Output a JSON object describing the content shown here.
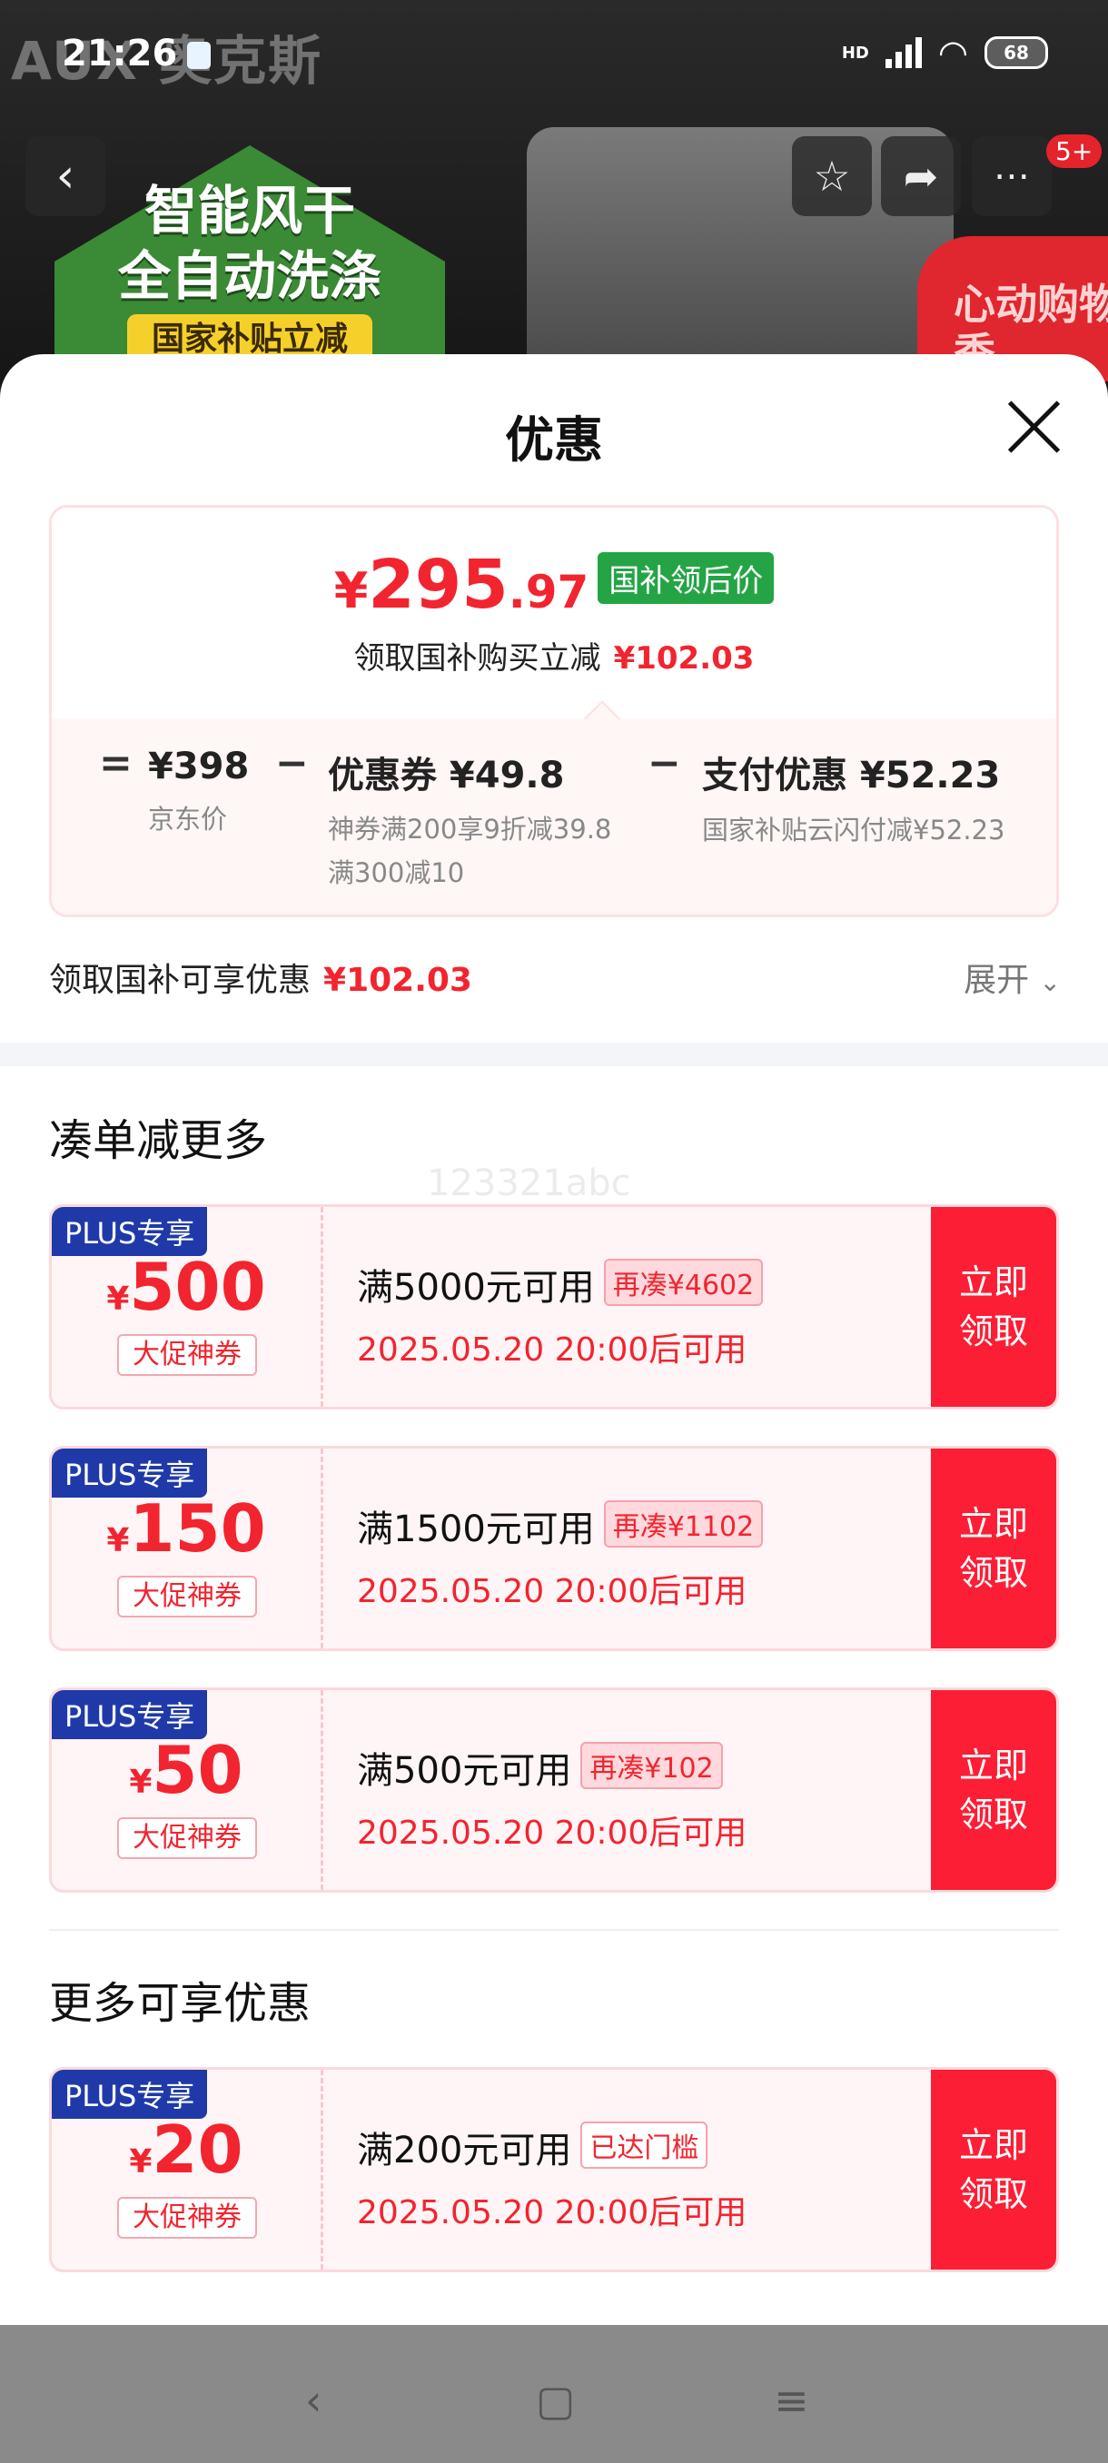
{
  "status": {
    "time": "21:26",
    "network": "HD",
    "battery": "68"
  },
  "background": {
    "brand": "AUX 奥克斯",
    "headline_1": "智能风干",
    "headline_2": "全自动洗涤",
    "promo_line": "国家补贴立减",
    "badge": "心动购物季",
    "msg_count": "5+"
  },
  "sheet": {
    "title": "优惠",
    "price": {
      "yen": "¥",
      "int": "295",
      "dec": ".97",
      "tag": "国补领后价",
      "sub_label": "领取国补购买立减",
      "sub_value": "¥102.03"
    },
    "breakdown": [
      {
        "op": "=",
        "value": "¥398",
        "label": "京东价"
      },
      {
        "op": "−",
        "value": "优惠券 ¥49.8",
        "label": "神券满200享9折减39.8",
        "label2": "满300减10"
      },
      {
        "op": "−",
        "value": "支付优惠 ¥52.23",
        "label": "国家补贴云闪付减¥52.23"
      }
    ],
    "save_label": "领取国补可享优惠",
    "save_value": "¥102.03",
    "expand_label": "展开",
    "section1_title": "凑单减更多",
    "section2_title": "更多可享优惠",
    "watermark": "123321abc",
    "coupons": [
      {
        "plus": "PLUS专享",
        "yen": "¥",
        "amount": "500",
        "tag": "大促神券",
        "condition": "满5000元可用",
        "chip": "再凑¥4602",
        "date": "2025.05.20 20:00后可用",
        "claim": "立即领取"
      },
      {
        "plus": "PLUS专享",
        "yen": "¥",
        "amount": "150",
        "tag": "大促神券",
        "condition": "满1500元可用",
        "chip": "再凑¥1102",
        "date": "2025.05.20 20:00后可用",
        "claim": "立即领取"
      },
      {
        "plus": "PLUS专享",
        "yen": "¥",
        "amount": "50",
        "tag": "大促神券",
        "condition": "满500元可用",
        "chip": "再凑¥102",
        "date": "2025.05.20 20:00后可用",
        "claim": "立即领取"
      },
      {
        "plus": "PLUS专享",
        "yen": "¥",
        "amount": "20",
        "tag": "大促神券",
        "condition": "满200元可用",
        "chip": "已达门槛",
        "date": "2025.05.20 20:00后可用",
        "claim": "立即领取"
      }
    ]
  },
  "colors": {
    "accent": "#f2242f",
    "claim_bg": "#fc1e35",
    "plus_bg": "#1f3aa8",
    "tag_green": "#25a446"
  },
  "icons": [
    "back-icon",
    "star-icon",
    "share-icon",
    "more-icon",
    "close-icon",
    "chevron-down-icon",
    "nav-back-icon",
    "nav-home-icon",
    "nav-menu-icon"
  ]
}
